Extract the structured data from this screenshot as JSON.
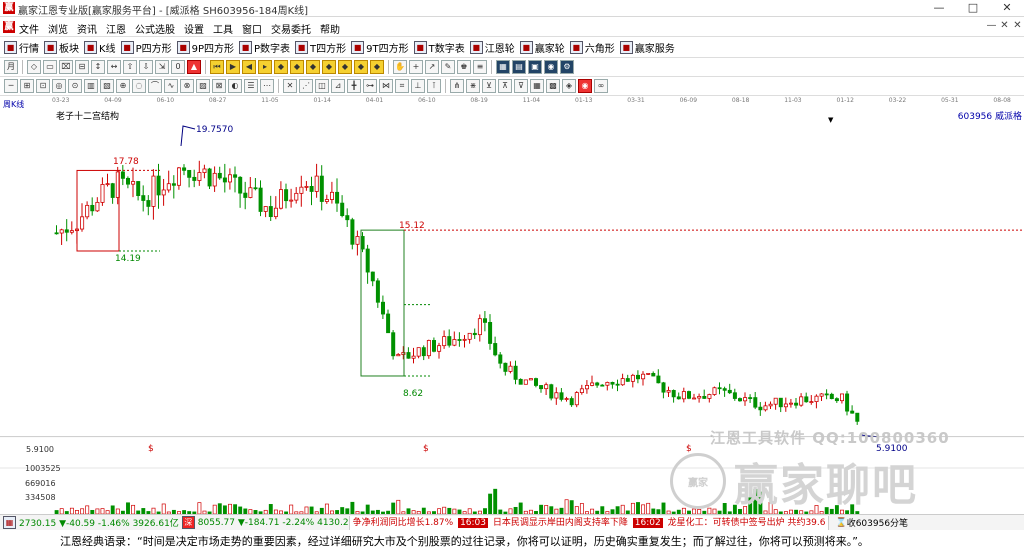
{
  "window": {
    "title": "赢家江恩专业版[赢家服务平台] - [威派格  SH603956-184周K线]",
    "min": "—",
    "max": "□",
    "close": "✕"
  },
  "menu": {
    "items": [
      "文件",
      "浏览",
      "资讯",
      "江恩",
      "公式选股",
      "设置",
      "工具",
      "窗口",
      "交易委托",
      "帮助"
    ],
    "mdi": [
      "—",
      "✕",
      "✕"
    ]
  },
  "toolbar": {
    "items": [
      {
        "icon": "grid-icon",
        "label": "行情"
      },
      {
        "icon": "blocks-icon",
        "label": "板块"
      },
      {
        "icon": "candle-icon",
        "label": "K线"
      },
      {
        "icon": "p-square-icon",
        "label": "P四方形"
      },
      {
        "icon": "9p-square-icon",
        "label": "9P四方形"
      },
      {
        "icon": "p-table-icon",
        "label": "P数字表"
      },
      {
        "icon": "t-square-icon",
        "label": "T四方形"
      },
      {
        "icon": "9t-square-icon",
        "label": "9T四方形"
      },
      {
        "icon": "t-table-icon",
        "label": "T数字表"
      },
      {
        "icon": "gann-wheel-icon",
        "label": "江恩轮"
      },
      {
        "icon": "winner-wheel-icon",
        "label": "赢家轮"
      },
      {
        "icon": "hexagon-icon",
        "label": "六角形"
      },
      {
        "icon": "service-icon",
        "label": "赢家服务"
      }
    ]
  },
  "chart": {
    "period_label": "周K线",
    "title": "老子十二宫结构",
    "stock": "603956  威派格",
    "dates": [
      "03-23",
      "04-09",
      "06-10",
      "08-27",
      "11-05",
      "01-14",
      "04-01",
      "06-10",
      "08-19",
      "11-04",
      "01-13",
      "03-31",
      "06-09",
      "08-18",
      "11-03",
      "01-12",
      "03-22",
      "05-31",
      "08-08"
    ],
    "annotations": {
      "high": "19.7570",
      "box1_top": "17.78",
      "box1_bottom": "14.19",
      "box2_top": "15.12",
      "box2_bottom": "8.62",
      "last_low": "5.9100"
    },
    "price_axis": "5.9100",
    "volume_axis": [
      "1003525",
      "669016",
      "334508"
    ],
    "dividend_mark": "$",
    "colors": {
      "up": "#d00000",
      "down": "#009000",
      "box": "#208020",
      "marker": "#000080"
    }
  },
  "watermark": {
    "line1": "江恩工具软件  QQ:100800360",
    "logo": "赢家",
    "text": "赢家聊吧"
  },
  "status": {
    "sh": "2730.15 ▼-40.59 -1.46% 3926.61亿",
    "sz": "8055.77 ▼-184.71 -2.24% 4130.2",
    "ticker": "争净利润同比增长1.87%",
    "t1": "16:03",
    "news1": "日本民调显示岸田内阁支持率下降",
    "t2": "16:02",
    "news2": "龙星化工：可转债中签号出炉 共约39.6",
    "right": "收603956分笔"
  },
  "quote": "江恩经典语录：“时间是决定市场走势的重要因素，经过详细研究大市及个别股票的过往记录，你将可以证明，历史确实重复发生；而了解过往，你将可以预测将来。”。"
}
